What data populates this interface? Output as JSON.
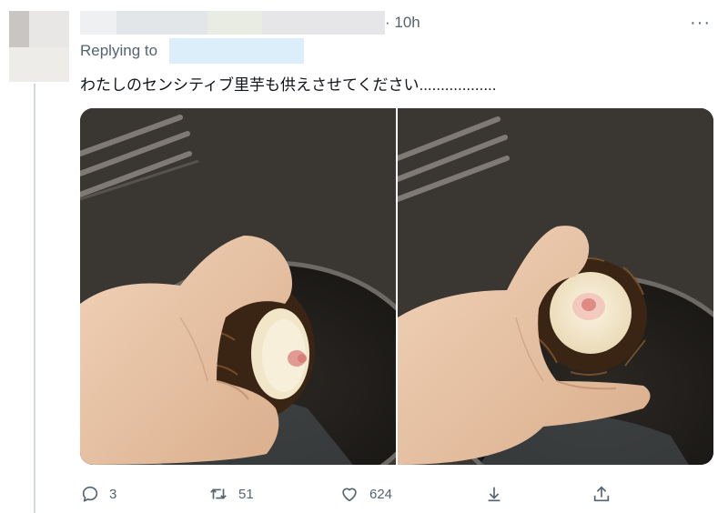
{
  "tweet": {
    "time": "· 10h",
    "replying_label": "Replying to",
    "text": "わたしのセンシティブ里芋も供えさせてください..................",
    "more_label": "···"
  },
  "media": {
    "left_photo": "taro-photo-side-view",
    "right_photo": "taro-photo-front-view"
  },
  "actions": {
    "reply_count": "3",
    "retweet_count": "51",
    "like_count": "624"
  },
  "icons": {
    "reply": "reply-icon",
    "retweet": "retweet-icon",
    "like": "like-icon",
    "bookmark": "bookmark-icon",
    "share": "share-icon"
  },
  "colors": {
    "muted": "#536471",
    "text": "#0f1419",
    "redaction": "#ddeefb"
  }
}
